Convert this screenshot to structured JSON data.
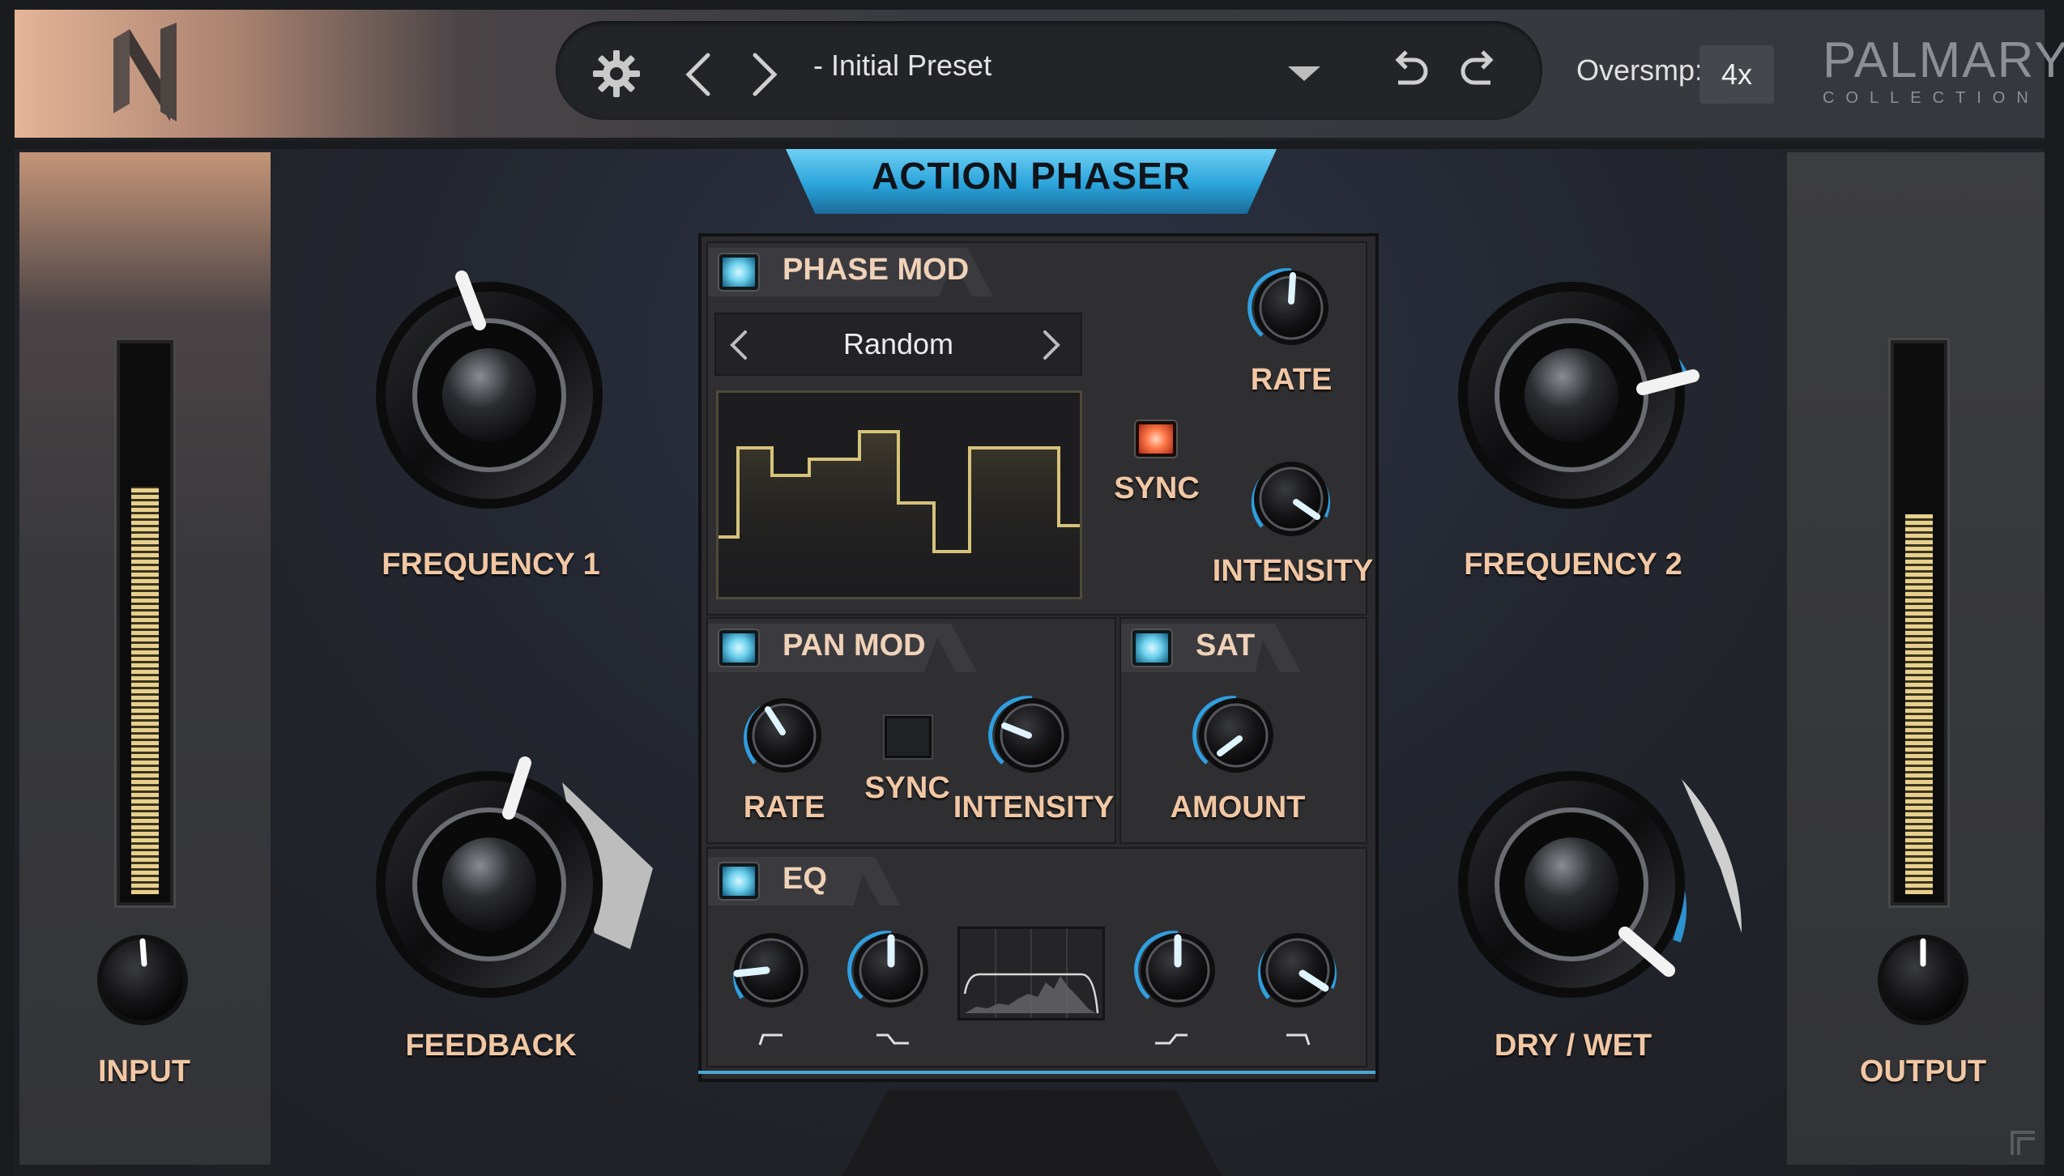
{
  "header": {
    "preset_name": "- Initial Preset",
    "oversampling_label": "Oversmp:",
    "oversampling_value": "4x",
    "brand_name": "PALMARY",
    "brand_sub": "COLLECTION"
  },
  "title": "ACTION PHASER",
  "knobs": {
    "frequency1": "FREQUENCY 1",
    "feedback": "FEEDBACK",
    "frequency2": "FREQUENCY 2",
    "drywet": "DRY / WET",
    "input": "INPUT",
    "output": "OUTPUT"
  },
  "meters": {
    "input_level": 0.75,
    "output_level": 0.7
  },
  "phase_mod": {
    "title": "PHASE MOD",
    "mode": "Random",
    "sync_label": "SYNC",
    "rate_label": "RATE",
    "intensity_label": "INTENSITY"
  },
  "pan_mod": {
    "title": "PAN MOD",
    "rate_label": "RATE",
    "sync_label": "SYNC",
    "intensity_label": "INTENSITY"
  },
  "sat": {
    "title": "SAT",
    "amount_label": "AMOUNT"
  },
  "eq": {
    "title": "EQ"
  },
  "colors": {
    "accent": "#3aa6e0",
    "label": "#f1c7a4",
    "meter": "#e8d08c",
    "sync_led": "#ff7a4a"
  }
}
